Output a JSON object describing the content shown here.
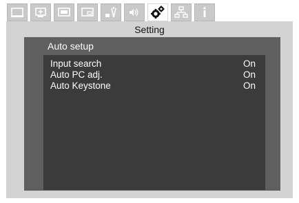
{
  "tabs": [
    {
      "icon": "screen-icon",
      "active": false
    },
    {
      "icon": "input-icon",
      "active": false
    },
    {
      "icon": "image-adjust-icon",
      "active": false
    },
    {
      "icon": "picture-in-picture-icon",
      "active": false
    },
    {
      "icon": "display-setup-icon",
      "active": false
    },
    {
      "icon": "sound-icon",
      "active": false
    },
    {
      "icon": "gears-icon",
      "active": true
    },
    {
      "icon": "network-icon",
      "active": false
    },
    {
      "icon": "information-icon",
      "active": false
    }
  ],
  "dialog": {
    "title": "Setting"
  },
  "panel": {
    "title": "Auto setup",
    "items": [
      {
        "label": "Input search",
        "value": "On"
      },
      {
        "label": "Auto PC adj.",
        "value": "On"
      },
      {
        "label": "Auto Keystone",
        "value": "On"
      }
    ]
  },
  "colors": {
    "tab_inactive": "#c9c9c9",
    "dialog_bg": "#d3d3d3",
    "panel_bg": "#5f5f5f",
    "list_bg": "#3b3b3b",
    "text_light": "#ffffff"
  }
}
